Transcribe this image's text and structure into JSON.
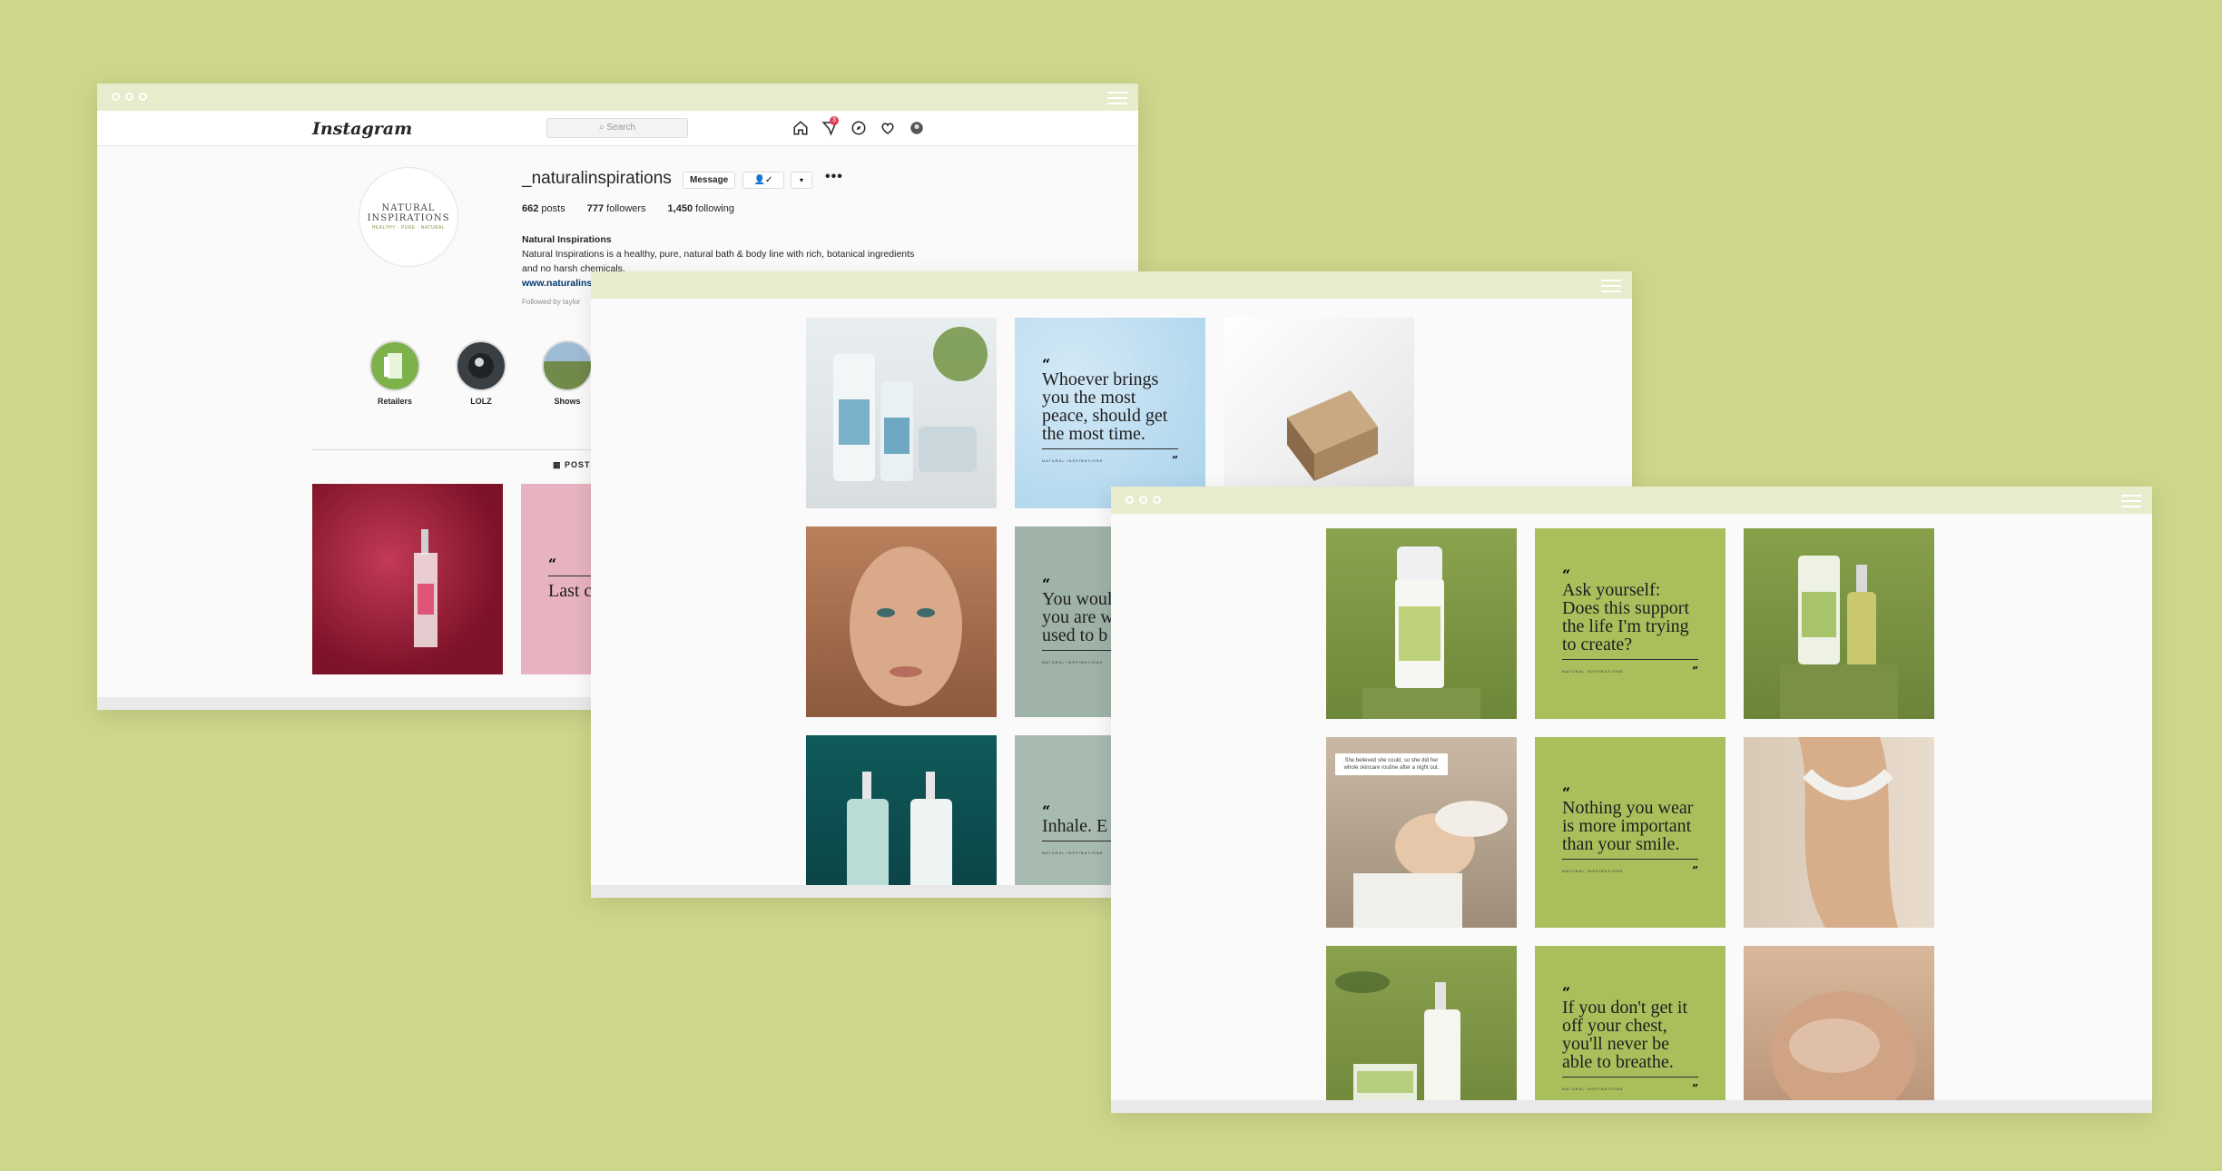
{
  "colors": {
    "background": "#cdd68a",
    "window_bar": "#e7eccc",
    "sage": "#9fb3a8",
    "olive": "#a9bf5c"
  },
  "instagram": {
    "logo": "Instagram",
    "search_placeholder": "Search",
    "notification_count": "3",
    "username": "_naturalinspirations",
    "message_label": "Message",
    "follow_label": "👤✓",
    "dropdown_label": "▾",
    "more_label": "•••",
    "stats": {
      "posts_count": "662",
      "posts_label": "posts",
      "followers_count": "777",
      "followers_label": "followers",
      "following_count": "1,450",
      "following_label": "following"
    },
    "bio_name": "Natural Inspirations",
    "bio_text": "Natural Inspirations is a healthy, pure, natural bath & body line with rich, botanical ingredients and no harsh chemicals.",
    "bio_link": "www.naturalinspirations.com/natural-inspirations-blog/skin-care-during-can…",
    "followed_by": "Followed by taylor",
    "avatar_logo": {
      "line1": "NATURAL",
      "line2": "INSPIRATIONS",
      "tagline": "HEALTHY · PURE · NATURAL"
    },
    "highlights": [
      {
        "label": "Retailers"
      },
      {
        "label": "LOLZ"
      },
      {
        "label": "Shows"
      }
    ],
    "posts_tab": "POSTS",
    "grid_quote_partial": "Last c off all"
  },
  "window2": {
    "quotes": [
      {
        "text": "Whoever brings you the most peace, should get the most time.",
        "brand": "NATURAL INSPIRATIONS"
      },
      {
        "text": "You would who you are without w used to b",
        "brand": "NATURAL INSPIRATIONS"
      },
      {
        "text": "Inhale. E",
        "brand": "NATURAL INSPIRATIONS"
      }
    ]
  },
  "window3": {
    "quotes": [
      {
        "text": "Ask yourself: Does this support the life I'm trying to create?",
        "brand": "NATURAL INSPIRATIONS"
      },
      {
        "text": "Nothing you wear is more important than your smile.",
        "brand": "NATURAL INSPIRATIONS"
      },
      {
        "text": "If you don't get it off your chest, you'll never be able to breathe.",
        "brand": "NATURAL INSPIRATIONS"
      }
    ],
    "photo_caption": "She believed she could, so she did her whole skincare routine after a night out."
  },
  "quote_marks": {
    "open": "“",
    "close": "”"
  }
}
